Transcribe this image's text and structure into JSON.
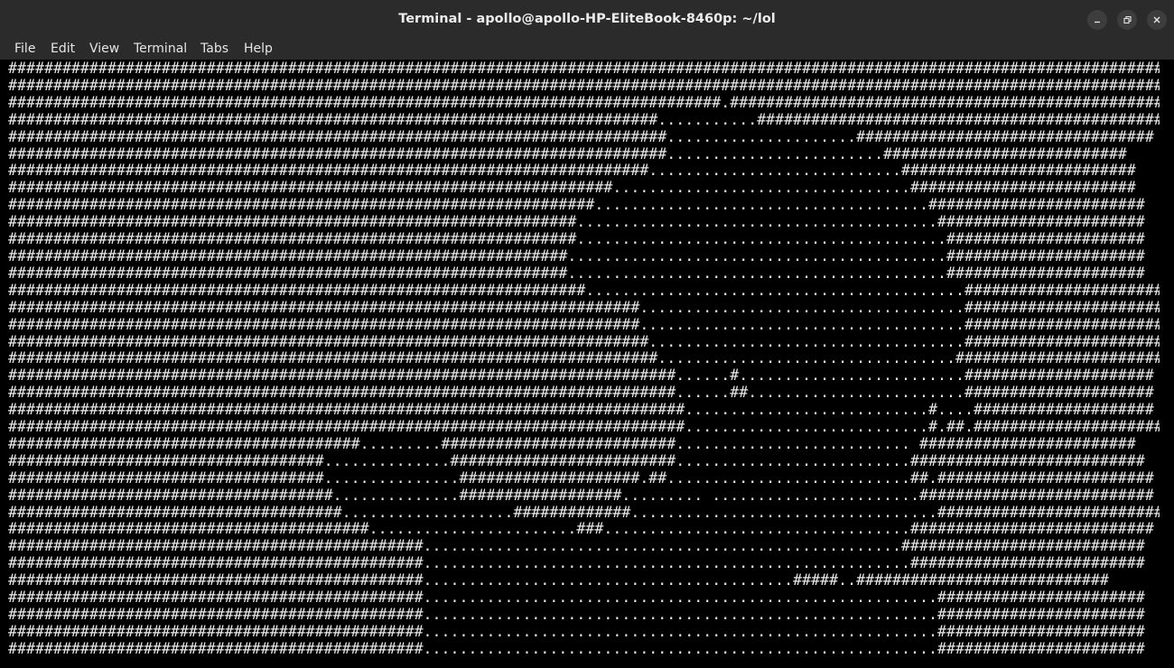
{
  "window": {
    "title": "Terminal - apollo@apollo-HP-EliteBook-8460p: ~/lol",
    "controls": [
      "minimize",
      "maximize",
      "close"
    ]
  },
  "menu": [
    "File",
    "Edit",
    "View",
    "Terminal",
    "Tabs",
    "Help"
  ],
  "terminal": {
    "lines": [
      "################################################################################################################################",
      "################################################################################################################################",
      "###############################################################################.################################################",
      "########################################################################...........##############################################",
      "#########################################################################.....................#################################",
      "#########################################################################........................###########################",
      "#######################################################################............................##########################",
      "###################################################################.................................#########################",
      "#################################################################.....................................########################",
      "###############################################################........................................#######################",
      "###############################################################.........................................######################",
      "##############################################################..........................................######################",
      "##############################################################..........................................######################",
      "################################################################..........................................######################",
      "######################################################################....................................######################",
      "######################################################################....................................######################",
      "#######################################################################...................................######################",
      "########################################################################.................................#######################",
      "##########################################################################......#.........................#####################",
      "##########################################################################......##........................#####################",
      "###########################################################################...........................#....####################",
      "###########################################################################...........................#.##.#####################",
      "#######################################.........##########################.......................... ########################",
      "###################################..............#########################..........................##########################",
      "###################################...............####################.##...........................##.########################",
      "####################################..............##################......... .......................##########################",
      "#####################################...................#############..................................#########################",
      "########################################.......................###..................................###########################",
      "##############################################.....................................................###########################",
      "##############################################......................................................##########################",
      "##############################################.........................................#####..############################",
      "##############################################.........................................................#######################",
      "##############################################.........................................................#######################",
      "##############################################.........................................................#######################",
      "##############################################.........................................................#######################"
    ]
  }
}
